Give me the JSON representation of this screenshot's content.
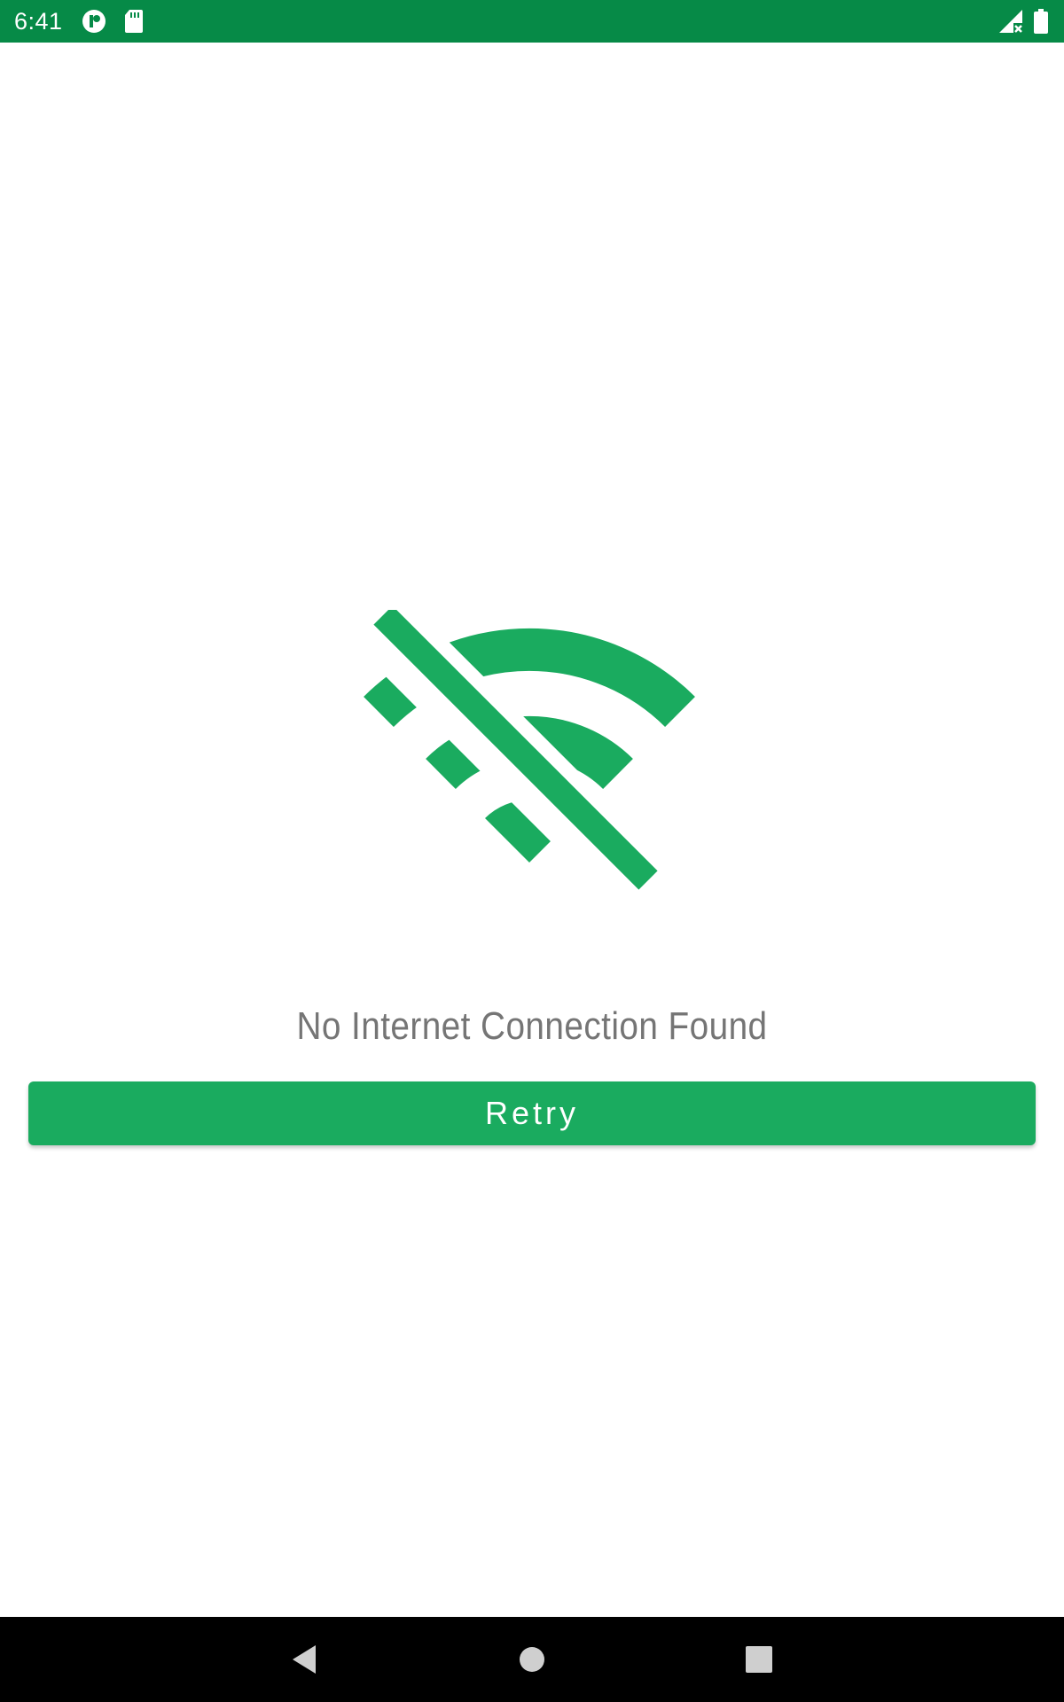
{
  "status_bar": {
    "time": "6:41",
    "left_icons": [
      "notification-app-icon",
      "sd-card-icon"
    ],
    "right_icons": [
      "signal-no-data-icon",
      "battery-icon"
    ],
    "background": "#068a47"
  },
  "main": {
    "illustration_icon": "wifi-off-icon",
    "message": "No Internet Connection Found",
    "retry_label": "Retry",
    "accent_color": "#1aab5f"
  },
  "nav_bar": {
    "buttons": [
      "back-icon",
      "home-icon",
      "recents-icon"
    ]
  }
}
